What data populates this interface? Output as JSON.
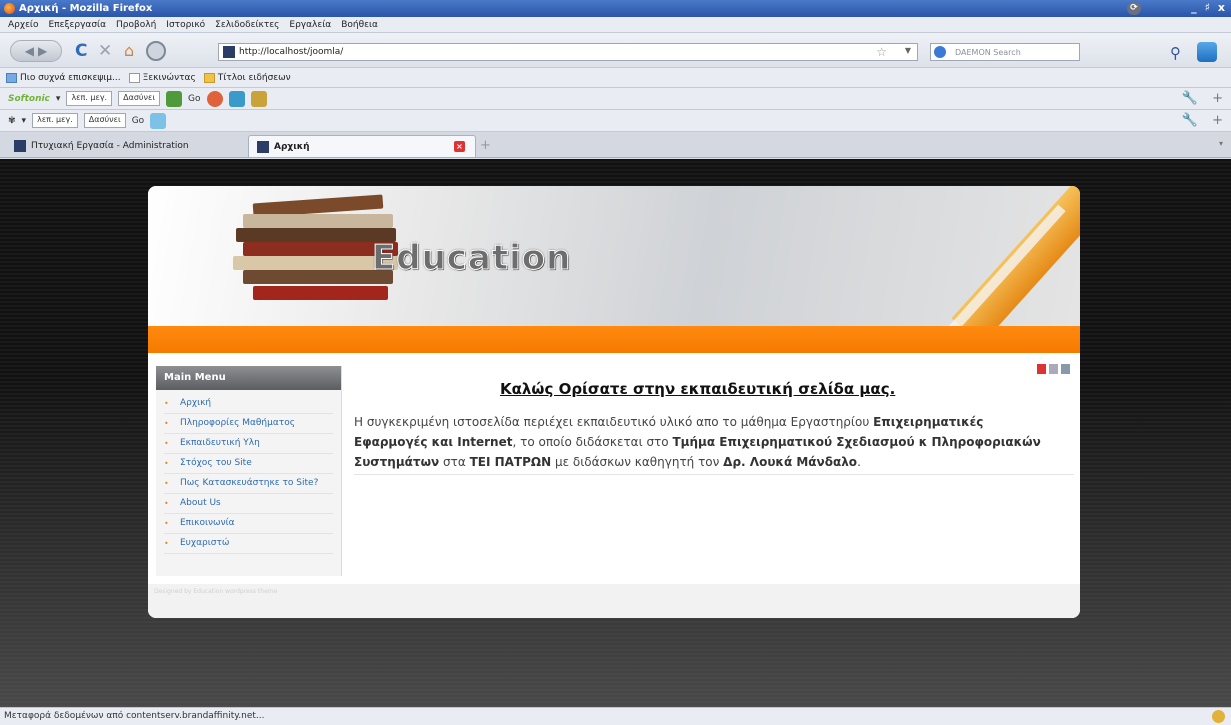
{
  "window": {
    "title": "Αρχική - Mozilla Firefox",
    "controls": [
      "_",
      "♯",
      "x"
    ]
  },
  "menubar": [
    "Αρχείο",
    "Επεξεργασία",
    "Προβολή",
    "Ιστορικό",
    "Σελιδοδείκτες",
    "Εργαλεία",
    "Βοήθεια"
  ],
  "nav": {
    "url": "http://localhost/joomla/",
    "search_placeholder": "DAEMON Search"
  },
  "bookmarks": [
    {
      "label": "Πιο συχνά επισκεψιμ...",
      "icon": "blue-bookmark-icon"
    },
    {
      "label": "Ξεκινώντας",
      "icon": "page-icon"
    },
    {
      "label": "Τίτλοι ειδήσεων",
      "icon": "folder-icon"
    }
  ],
  "toolbar1": {
    "brand": "Softonic",
    "sel1": "λεπ. μεγ.",
    "sel2": "Δασύνει",
    "go": "Go"
  },
  "toolbar2": {
    "sel1": "λεπ. μεγ.",
    "sel2": "Δασύνει",
    "go": "Go"
  },
  "tabs": [
    {
      "label": "Πτυχιακή Εργασία - Administration",
      "active": false
    },
    {
      "label": "Αρχική",
      "active": true
    }
  ],
  "site": {
    "logo": "Education",
    "menu_title": "Main Menu",
    "menu_items": [
      "Αρχική",
      "Πληροφορίες Μαθήματος",
      "Εκπαιδευτική Υλη",
      "Στόχος του Site",
      "Πως Κατασκευάστηκε το Site?",
      "About Us",
      "Επικοινωνία",
      "Ευχαριστώ"
    ],
    "main_title": "Καλώς Ορίσατε στην εκπαιδευτική σελίδα μας.",
    "p1": "Η συγκεκριμένη ιστοσελίδα περιέχει εκπαιδευτικό υλικό απο το μάθημα Εργαστηρίου ",
    "b1": "Επιχειρηματικές Εφαρμογές και Internet",
    "p2": ", το οποίο διδάσκεται στο ",
    "b2": "Τμήμα Επιχειρηματικού Σχεδιασμού κ Πληροφοριακών Συστημάτων",
    "p3": " στα ",
    "b3": "ΤΕΙ ΠΑΤΡΩΝ",
    "p4": " με διδάσκων καθηγητή τον ",
    "b4": "Δρ. Λουκά Μάνδαλο",
    "p5": ".",
    "designed": "Designed by Education wordpress theme"
  },
  "status": "Μεταφορά δεδομένων από contentserv.brandaffinity.net..."
}
